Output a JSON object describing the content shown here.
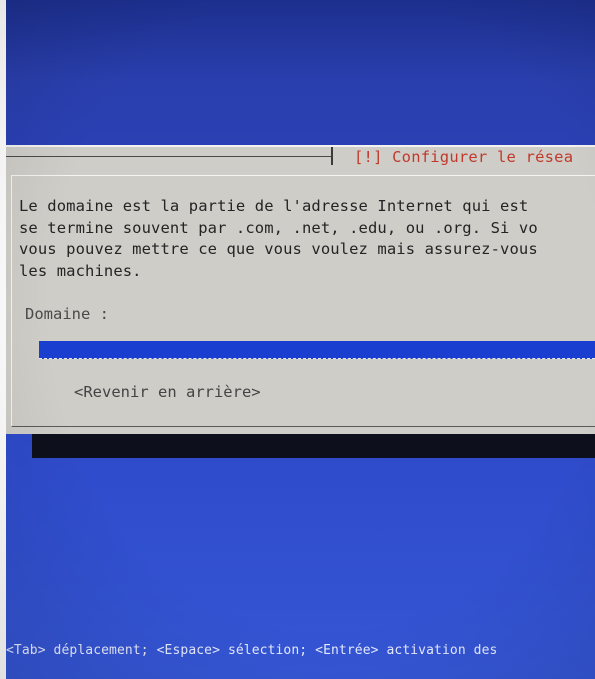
{
  "dialog": {
    "title": "[!] Configurer le résea",
    "description": "Le domaine est la partie de l'adresse Internet qui est \nse termine souvent par .com, .net, .edu, ou .org. Si vo\nvous pouvez mettre ce que vous voulez mais assurez-vous \nles machines.",
    "field_label": "Domaine :",
    "field_value": "",
    "back_button": "<Revenir en arrière>"
  },
  "help_bar": "<Tab> déplacement; <Espace> sélection; <Entrée> activation des",
  "colors": {
    "screen_background": "#2c44c2",
    "dialog_background": "#cfcdc8",
    "title_text": "#c0392b",
    "input_background": "#1a3fd0"
  }
}
